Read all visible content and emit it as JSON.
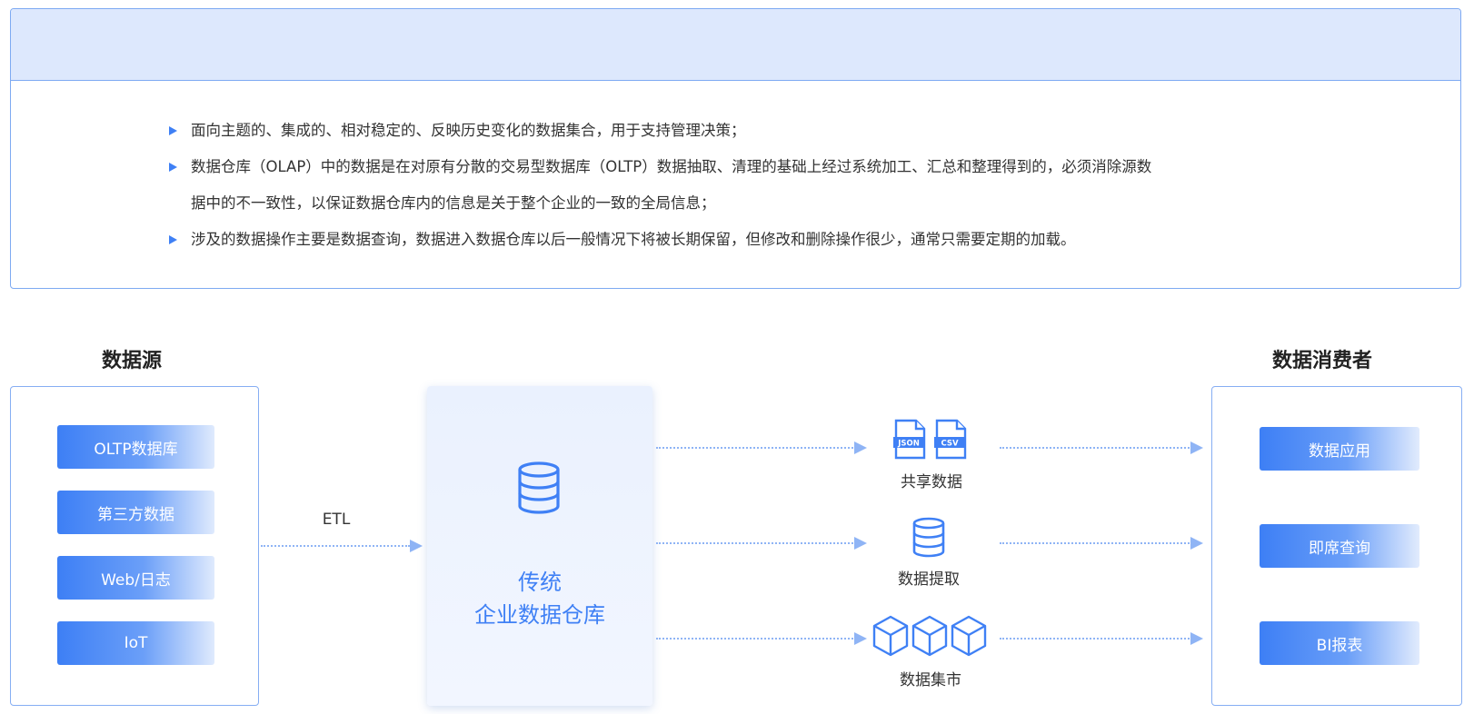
{
  "description": {
    "bullets": [
      "面向主题的、集成的、相对稳定的、反映历史变化的数据集合，用于支持管理决策；",
      "数据仓库（OLAP）中的数据是在对原有分散的交易型数据库（OLTP）数据抽取、清理的基础上经过系统加工、汇总和整理得到的，必须消除源数",
      "涉及的数据操作主要是数据查询，数据进入数据仓库以后一般情况下将被长期保留，但修改和删除操作很少，通常只需要定期的加载。"
    ],
    "bullet2_continuation": "据中的不一致性，以保证数据仓库内的信息是关于整个企业的一致的全局信息；"
  },
  "sources": {
    "title": "数据源",
    "items": [
      "OLTP数据库",
      "第三方数据",
      "Web/日志",
      "IoT"
    ]
  },
  "etl_label": "ETL",
  "warehouse": {
    "line1": "传统",
    "line2": "企业数据仓库"
  },
  "outputs": {
    "shared": {
      "label": "共享数据",
      "json_tag": "JSON",
      "csv_tag": "CSV"
    },
    "extract": {
      "label": "数据提取"
    },
    "mart": {
      "label": "数据集市"
    }
  },
  "consumers": {
    "title": "数据消费者",
    "items": [
      "数据应用",
      "即席查询",
      "BI报表"
    ]
  },
  "colors": {
    "accent": "#3f80f5",
    "border": "#86aef3",
    "header_bg": "#dde8fd",
    "arrow": "#8fb4f5"
  }
}
